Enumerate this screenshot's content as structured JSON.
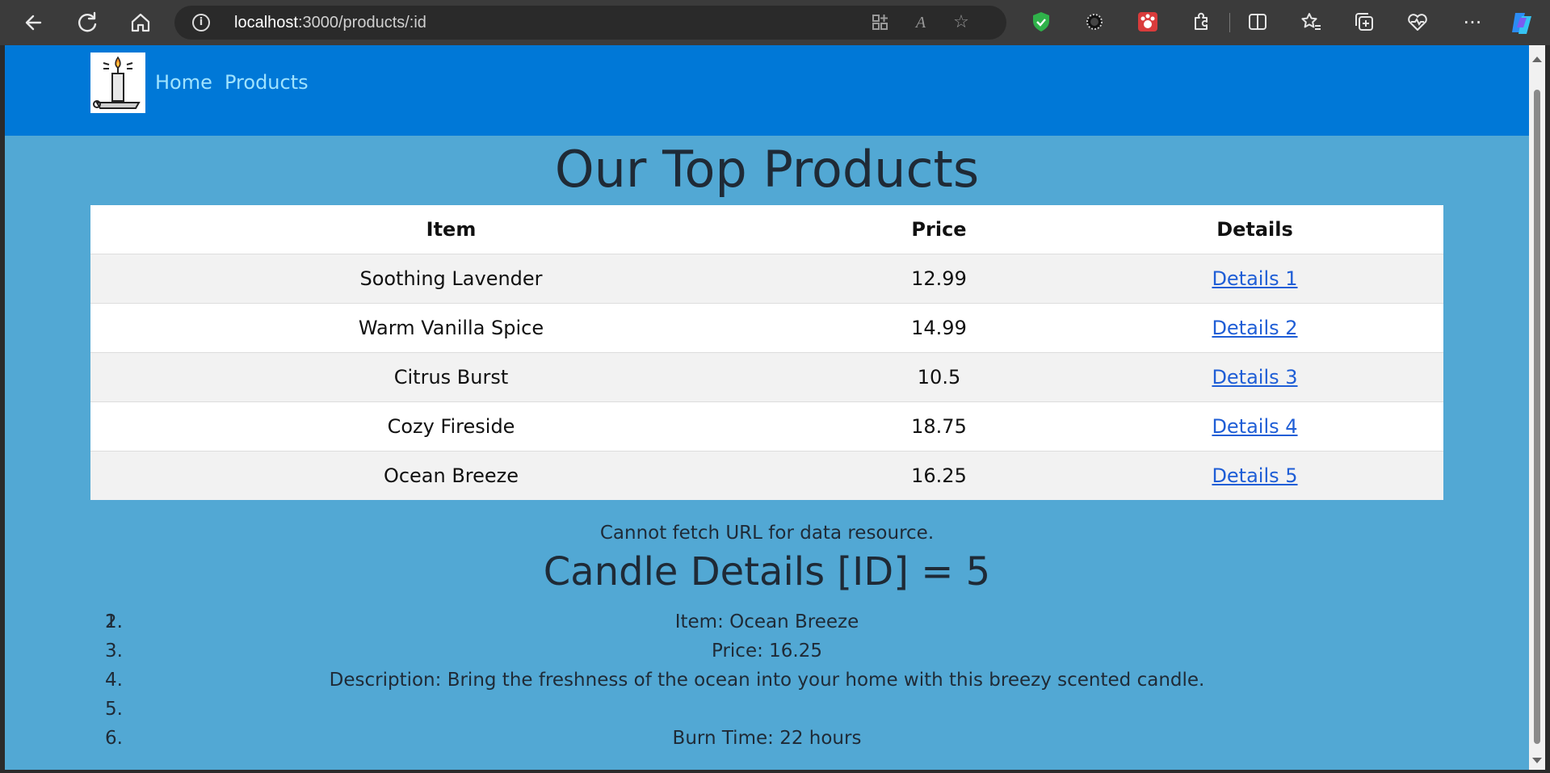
{
  "browser": {
    "url_host": "localhost",
    "url_rest": ":3000/products/:id"
  },
  "nav": {
    "links": [
      "Home",
      "Products"
    ]
  },
  "page": {
    "title": "Our Top Products",
    "table": {
      "headers": [
        "Item",
        "Price",
        "Details"
      ],
      "rows": [
        {
          "item": "Soothing Lavender",
          "price": "12.99",
          "details": "Details 1"
        },
        {
          "item": "Warm Vanilla Spice",
          "price": "14.99",
          "details": "Details 2"
        },
        {
          "item": "Citrus Burst",
          "price": "10.5",
          "details": "Details 3"
        },
        {
          "item": "Cozy Fireside",
          "price": "18.75",
          "details": "Details 4"
        },
        {
          "item": "Ocean Breeze",
          "price": "16.25",
          "details": "Details 5"
        }
      ]
    },
    "error_message": "Cannot fetch URL for data resource.",
    "details_title": "Candle Details [ID] = 5",
    "details_list": {
      "overlapped_number": "1.",
      "items": [
        {
          "num": "2.",
          "text": "Item: Ocean Breeze"
        },
        {
          "num": "3.",
          "text": "Price: 16.25"
        },
        {
          "num": "4.",
          "text": "Description: Bring the freshness of the ocean into your home with this breezy scented candle."
        },
        {
          "num": "5.",
          "text": ""
        },
        {
          "num": "6.",
          "text": "Burn Time: 22 hours"
        }
      ]
    }
  },
  "colors": {
    "navbar": "#0078d7",
    "page_background": "#52a8d4",
    "nav_link": "#9fe3ff",
    "table_link": "#1f5ed6"
  }
}
